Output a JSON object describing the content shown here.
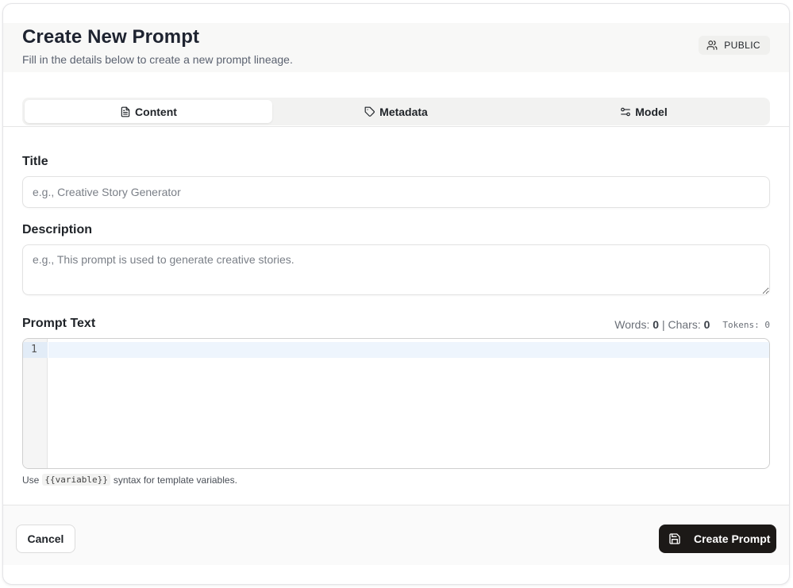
{
  "header": {
    "title": "Create New Prompt",
    "subtitle": "Fill in the details below to create a new prompt lineage.",
    "visibility_badge": "PUBLIC",
    "badge_icon": "users-icon"
  },
  "tabs": [
    {
      "label": "Content",
      "icon": "file-text-icon",
      "active": true
    },
    {
      "label": "Metadata",
      "icon": "tag-icon",
      "active": false
    },
    {
      "label": "Model",
      "icon": "sliders-icon",
      "active": false
    }
  ],
  "form": {
    "title_label": "Title",
    "title_placeholder": "e.g., Creative Story Generator",
    "title_value": "",
    "description_label": "Description",
    "description_placeholder": "e.g., This prompt is used to generate creative stories.",
    "description_value": "",
    "prompt_label": "Prompt Text",
    "words_label": "Words:",
    "words_value": "0",
    "chars_label": "Chars:",
    "chars_value": "0",
    "separator": "|",
    "tokens_text": "Tokens: 0",
    "line_number": "1",
    "hint_prefix": "Use",
    "hint_code": "{{variable}}",
    "hint_suffix": "syntax for template variables."
  },
  "footer": {
    "cancel_label": "Cancel",
    "create_label": "Create Prompt",
    "create_icon": "save-icon"
  },
  "colors": {
    "primary_button": "#1c1917",
    "header_bg": "#f8f8f7",
    "active_line": "#eef5fd"
  }
}
